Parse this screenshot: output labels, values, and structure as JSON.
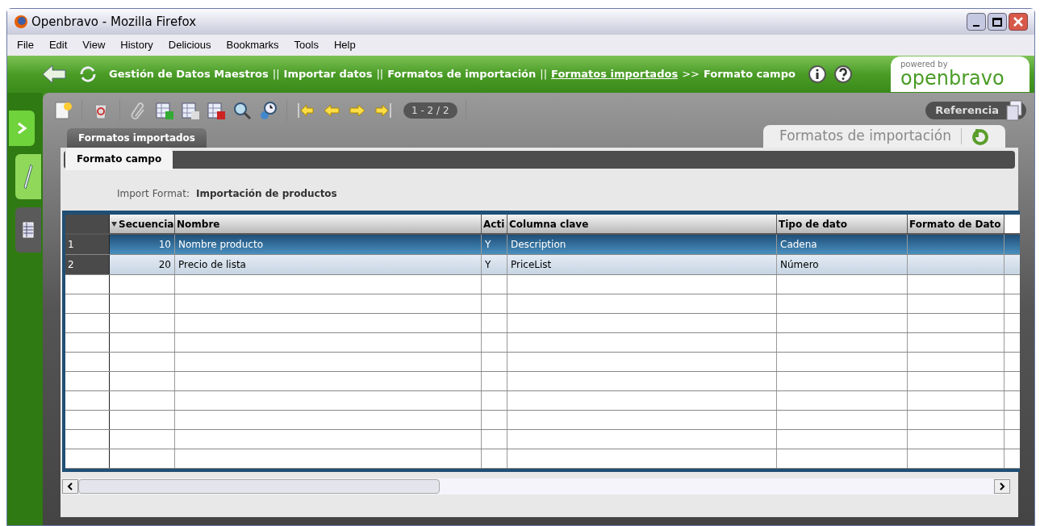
{
  "window": {
    "title": "Openbravo - Mozilla Firefox"
  },
  "menu": [
    "File",
    "Edit",
    "View",
    "History",
    "Delicious",
    "Bookmarks",
    "Tools",
    "Help"
  ],
  "breadcrumb": [
    {
      "kind": "text",
      "text": "Gestión de Datos Maestros"
    },
    {
      "kind": "separator",
      "text": "||"
    },
    {
      "kind": "text",
      "text": "Importar datos"
    },
    {
      "kind": "separator",
      "text": "||"
    },
    {
      "kind": "text",
      "text": "Formatos de importación"
    },
    {
      "kind": "separator",
      "text": "||"
    },
    {
      "kind": "link",
      "text": "Formatos importados"
    },
    {
      "kind": "separator",
      "text": ">>"
    },
    {
      "kind": "text",
      "text": "Formato campo"
    }
  ],
  "logo": {
    "tagline": "powered by",
    "name": "openbravo"
  },
  "toolbar": {
    "record_counter": "1 - 2 / 2",
    "reference_button": "Referencia"
  },
  "window_tab": "Formatos de importación",
  "tabs": [
    {
      "label": "Formatos importados",
      "selected": false
    },
    {
      "label": "Formato campo",
      "selected": true
    }
  ],
  "header_field": {
    "label": "Import Format:",
    "value": "Importación de productos"
  },
  "table": {
    "columns": [
      {
        "label": "Secuencia",
        "sorted": true
      },
      {
        "label": "Nombre",
        "sorted": false
      },
      {
        "label": "Acti",
        "sorted": false
      },
      {
        "label": "Columna clave",
        "sorted": false
      },
      {
        "label": "Tipo de dato",
        "sorted": false
      },
      {
        "label": "Formato de Dato",
        "sorted": false
      }
    ],
    "rows": [
      {
        "number": "1",
        "selected": true,
        "cells": [
          "10",
          "Nombre producto",
          "Y",
          "Description",
          "Cadena",
          ""
        ]
      },
      {
        "number": "2",
        "selected": false,
        "cells": [
          "20",
          "Precio de lista",
          "Y",
          "PriceList",
          "Número",
          ""
        ]
      }
    ]
  }
}
